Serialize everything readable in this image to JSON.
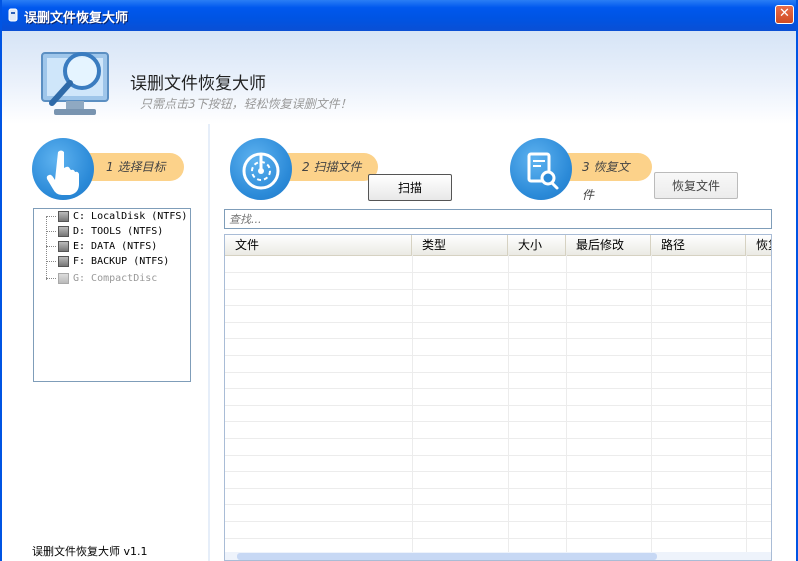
{
  "window": {
    "title": "误删文件恢复大师",
    "close_glyph": "✕"
  },
  "header": {
    "app_title": "误删文件恢复大师",
    "slogan": "只需点击3下按钮，轻松恢复误删文件！"
  },
  "steps": {
    "select": {
      "label": "1 选择目标",
      "icon": "hand-pointer-icon"
    },
    "scan": {
      "label": "2 扫描文件",
      "icon": "radar-scan-icon",
      "button": "扫描"
    },
    "recover": {
      "label": "3 恢复文件",
      "icon": "document-search-icon",
      "button": "恢复文件"
    }
  },
  "drives": [
    {
      "label": "C: LocalDisk (NTFS)",
      "enabled": true
    },
    {
      "label": "D: TOOLS (NTFS)",
      "enabled": true
    },
    {
      "label": "E: DATA (NTFS)",
      "enabled": true
    },
    {
      "label": "F: BACKUP (NTFS)",
      "enabled": true
    },
    {
      "label": "G: CompactDisc",
      "enabled": false
    }
  ],
  "search": {
    "placeholder": "查找..."
  },
  "table": {
    "columns": [
      "文件",
      "类型",
      "大小",
      "最后修改",
      "路径",
      "恢复"
    ]
  },
  "footer": {
    "version": "误删文件恢复大师 v1.1"
  },
  "colors": {
    "titlebar": "#0054e3",
    "accent_pill": "#fcd28a",
    "step_circle": "#2b8ad8"
  }
}
